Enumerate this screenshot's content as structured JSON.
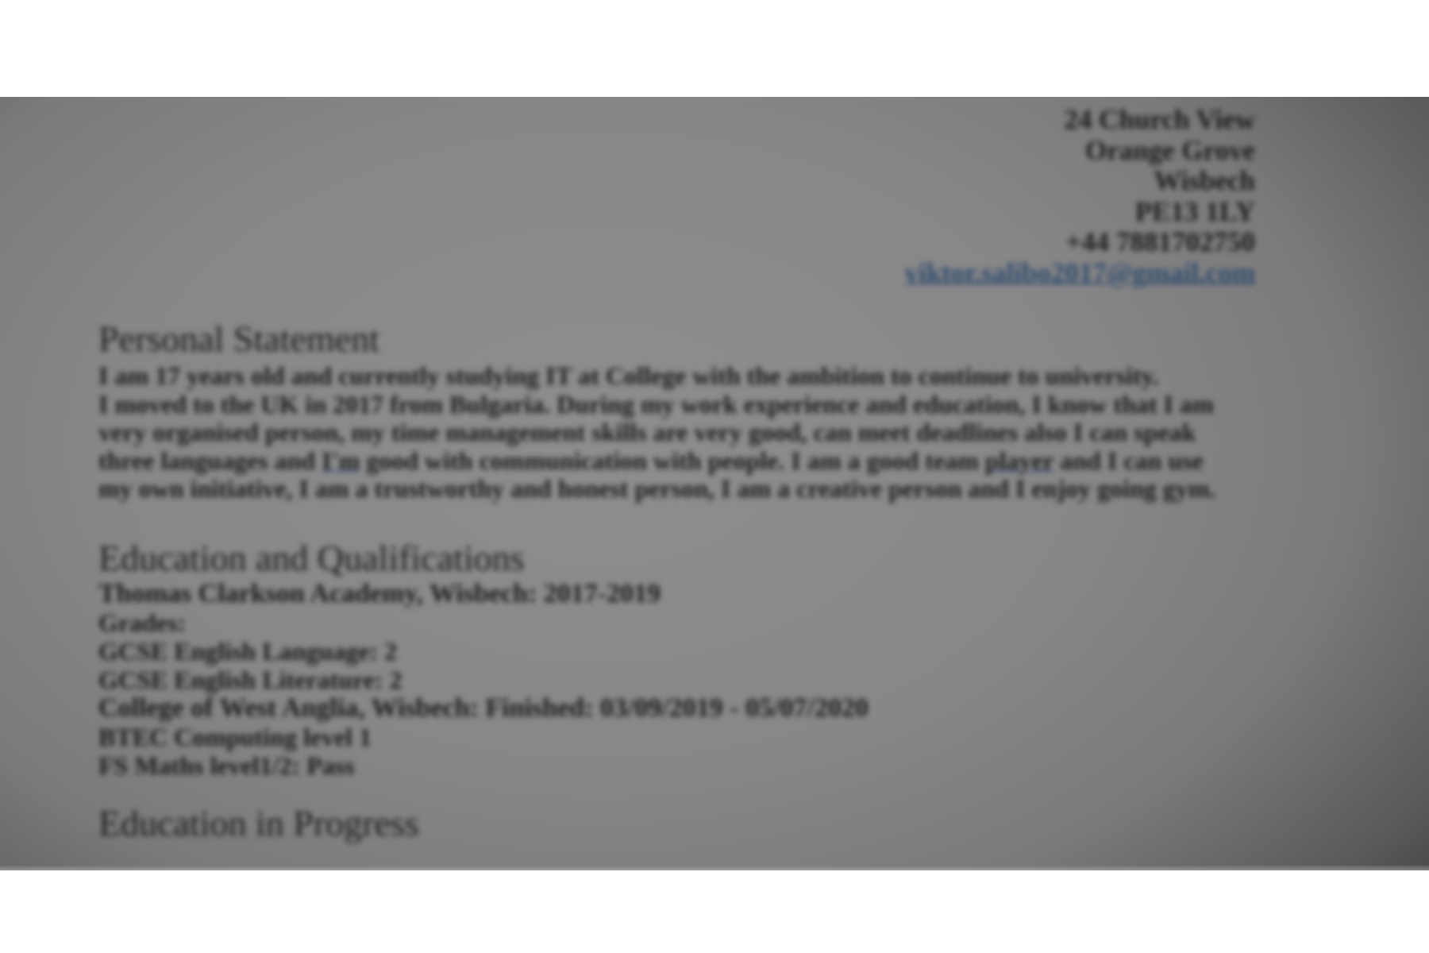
{
  "address": {
    "street": "24 Church View",
    "area": "Orange Grove",
    "town": "Wisbech",
    "postcode": "PE13 1LY",
    "phone": "+44 7881702750",
    "email": "viktor.salibo2017@gmail.com"
  },
  "personal_statement": {
    "heading": "Personal Statement",
    "line1": "I am 17 years old and currently studying IT at College with the ambition to continue to university.",
    "part_a": "I moved to the UK in 2017 from Bulgaria. During my work experience and education, I know that I am very organised person, my time management skills are very good, can meet deadlines also I can speak three languages and ",
    "word_im": "I'm",
    "part_b": " good with communication with people. I am a good team ",
    "word_player": "player",
    "part_c": " and I can use my own initiative, I am a trustworthy and honest person, I am a creative person and I enjoy going gym."
  },
  "education": {
    "heading": "Education and Qualifications",
    "lines": [
      "Thomas Clarkson Academy, Wisbech: 2017-2019",
      "Grades:",
      "GCSE English Language: 2",
      "GCSE English Literature: 2",
      "College of West Anglia, Wisbech: Finished: 03/09/2019 - 05/07/2020",
      "BTEC Computing level 1",
      "FS Maths level1/2: Pass"
    ]
  },
  "education_in_progress": {
    "heading": "Education in Progress"
  },
  "colors": {
    "text": "#1c1c1c",
    "link": "#2e4a6e",
    "band": "#878787"
  }
}
